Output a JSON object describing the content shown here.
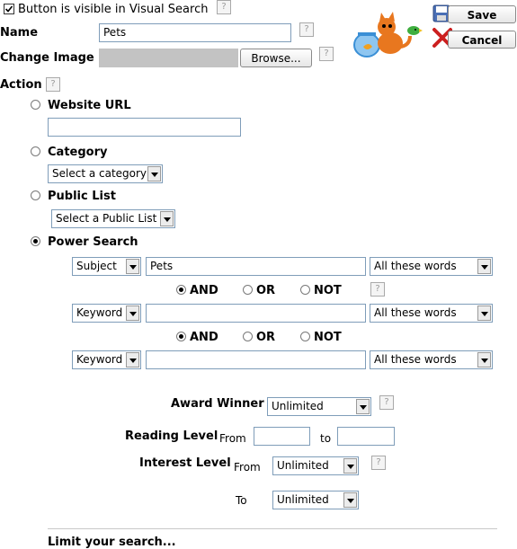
{
  "visibility": {
    "checked": true,
    "label": "Button is visible in Visual Search"
  },
  "name": {
    "label": "Name",
    "value": "Pets"
  },
  "change_image": {
    "label": "Change Image",
    "browse_label": "Browse..."
  },
  "actions": {
    "save_label": "Save",
    "cancel_label": "Cancel"
  },
  "action": {
    "label": "Action",
    "selected": "Power Search",
    "website_url": {
      "label": "Website URL",
      "value": ""
    },
    "category": {
      "label": "Category",
      "selected": "Select a category"
    },
    "public_list": {
      "label": "Public List",
      "selected": "Select a Public List"
    },
    "power_search": {
      "label": "Power Search"
    }
  },
  "power_search": {
    "rows": [
      {
        "field": "Subject",
        "value": "Pets",
        "match": "All these words"
      },
      {
        "field": "Keyword",
        "value": "",
        "match": "All these words"
      },
      {
        "field": "Keyword",
        "value": "",
        "match": "All these words"
      }
    ],
    "operators": [
      {
        "options": [
          "AND",
          "OR",
          "NOT"
        ],
        "selected": "AND"
      },
      {
        "options": [
          "AND",
          "OR",
          "NOT"
        ],
        "selected": "AND"
      }
    ]
  },
  "filters": {
    "award_winner": {
      "label": "Award Winner",
      "selected": "Unlimited"
    },
    "reading_level": {
      "label": "Reading Level",
      "from_label": "From",
      "to_label": "to",
      "from": "",
      "to": ""
    },
    "interest_level": {
      "label": "Interest Level",
      "from_label": "From",
      "to_label": "To",
      "from": "Unlimited",
      "to": "Unlimited"
    }
  },
  "limit": {
    "label": "Limit your search..."
  },
  "help_glyph": "?",
  "icons": {
    "save": "floppy-disk-icon",
    "cancel": "red-x-icon",
    "mascot": "cat-fishbowl-icon"
  },
  "colors": {
    "cancel_x": "#cc1f1f",
    "mascot_cat": "#e8771f",
    "fishbowl": "#3a8fd6",
    "bird": "#3fae3f"
  }
}
